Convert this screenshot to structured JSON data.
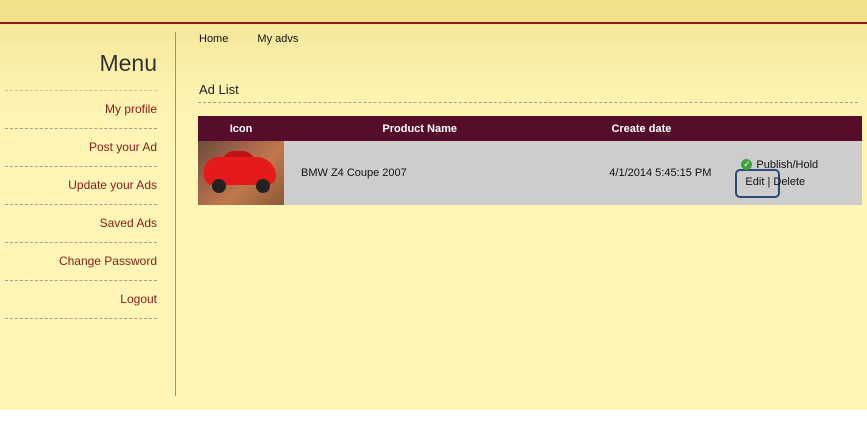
{
  "sidebar": {
    "title": "Menu",
    "items": [
      {
        "label": "My profile"
      },
      {
        "label": "Post your Ad"
      },
      {
        "label": "Update your Ads"
      },
      {
        "label": "Saved Ads"
      },
      {
        "label": "Change Password"
      },
      {
        "label": "Logout"
      }
    ]
  },
  "nav": {
    "links": [
      {
        "label": "Home"
      },
      {
        "label": "My advs"
      }
    ]
  },
  "section": {
    "title": "Ad List"
  },
  "table": {
    "headers": [
      "Icon",
      "Product Name",
      "Create date",
      ""
    ],
    "rows": [
      {
        "icon": "red-car-thumbnail",
        "name": "BMW Z4 Coupe 2007",
        "date": "4/1/2014 5:45:15 PM",
        "publish_label": "Publish/Hold",
        "edit_label": "Edit",
        "separator": "|",
        "delete_label": "Delete"
      }
    ]
  },
  "colors": {
    "accent": "#8e1a1a",
    "header_bg": "#560d2c",
    "page_bg": "#fff5b6",
    "row_bg": "#cfcdcc",
    "highlight": "#2b4a78"
  }
}
